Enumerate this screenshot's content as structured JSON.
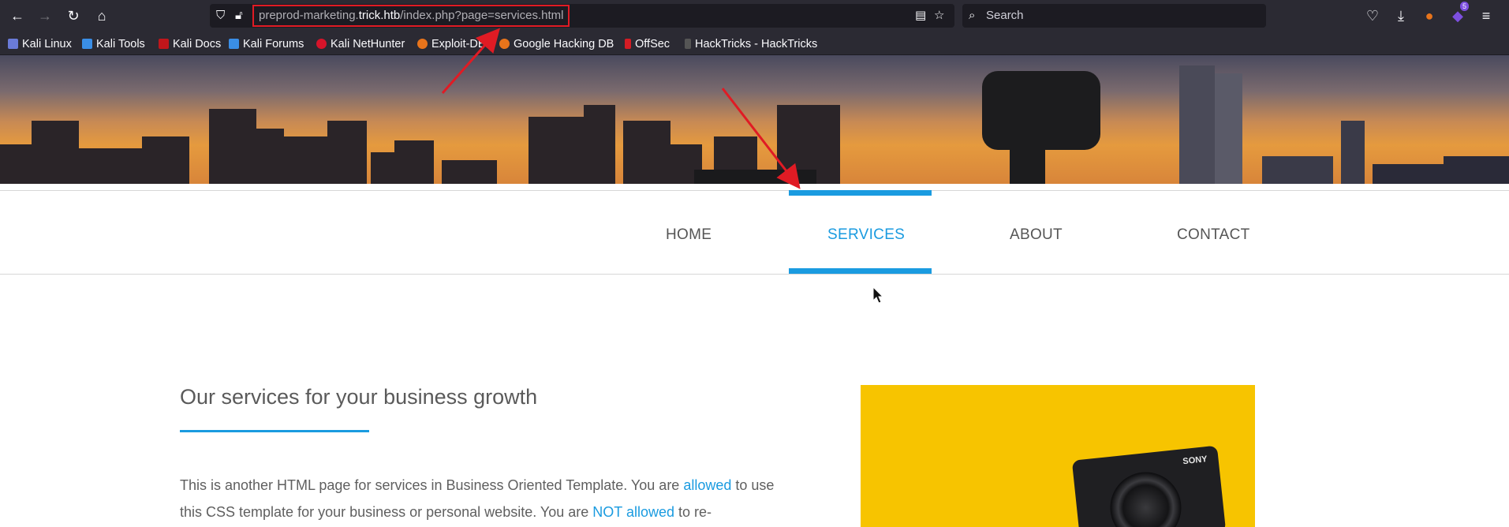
{
  "browser": {
    "url_host_prefix": "preprod-marketing.",
    "url_host": "trick.htb",
    "url_path": "/index.php?page=services.html",
    "search_placeholder": "Search",
    "bookmarks": [
      {
        "label": "Kali Linux",
        "color": "#6a7bd8"
      },
      {
        "label": "Kali Tools",
        "color": "#3a8ee6"
      },
      {
        "label": "Kali Docs",
        "color": "#c0161b"
      },
      {
        "label": "Kali Forums",
        "color": "#3a8ee6"
      },
      {
        "label": "Kali NetHunter",
        "color": "#d6142a"
      },
      {
        "label": "Exploit-DB",
        "color": "#e8741b"
      },
      {
        "label": "Google Hacking DB",
        "color": "#e8741b"
      },
      {
        "label": "OffSec",
        "color": "#d41c24"
      },
      {
        "label": "HackTricks - HackTricks",
        "color": "#333333"
      }
    ],
    "extension_badge": "5"
  },
  "nav": {
    "home": "HOME",
    "services": "SERVICES",
    "about": "ABOUT",
    "contact": "CONTACT",
    "active": "SERVICES",
    "accent_color": "#1a9be0"
  },
  "content": {
    "title": "Our services for your business growth",
    "para_1": "This is another HTML page for services in Business Oriented Template. You are ",
    "link_1": "allowed",
    "para_2": " to use this CSS template for your business or personal website. You are ",
    "link_2": "NOT allowed",
    "para_3": " to re-",
    "image_brand": "SONY"
  },
  "annotations": {
    "highlight_color": "#e01b24"
  }
}
